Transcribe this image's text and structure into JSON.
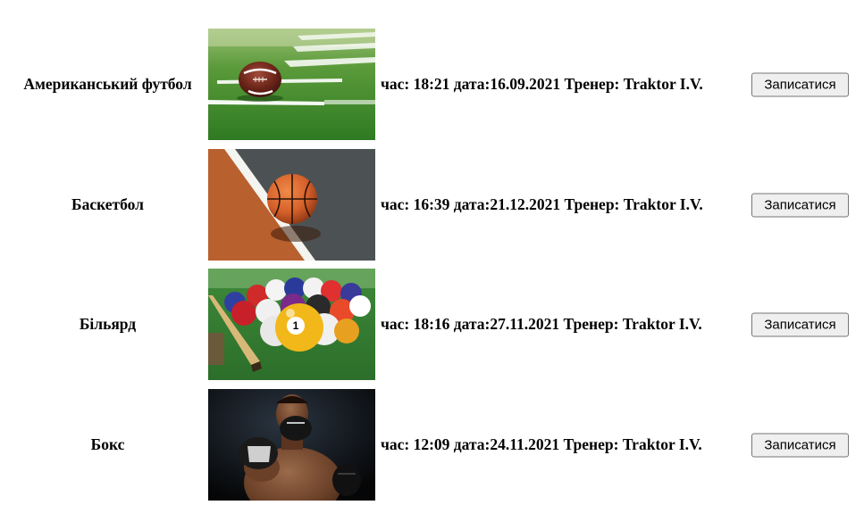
{
  "sections": [
    {
      "name": "Американський футбол",
      "time_label": "час:",
      "time": "18:21",
      "date_label": "дата:",
      "date": "16.09.2021",
      "trainer_label": "Тренер:",
      "trainer": "Traktor I.V.",
      "button_label": "Записатися",
      "image": "american-football-ball-on-field"
    },
    {
      "name": "Баскетбол",
      "time_label": "час:",
      "time": "16:39",
      "date_label": "дата:",
      "date": "21.12.2021",
      "trainer_label": "Тренер:",
      "trainer": "Traktor I.V.",
      "button_label": "Записатися",
      "image": "basketball-on-court"
    },
    {
      "name": "Більярд",
      "time_label": "час:",
      "time": "18:16",
      "date_label": "дата:",
      "date": "27.11.2021",
      "trainer_label": "Тренер:",
      "trainer": "Traktor I.V.",
      "button_label": "Записатися",
      "image": "billiard-balls-and-cue"
    },
    {
      "name": "Бокс",
      "time_label": "час:",
      "time": "12:09",
      "date_label": "дата:",
      "date": "24.11.2021",
      "trainer_label": "Тренер:",
      "trainer": "Traktor I.V.",
      "button_label": "Записатися",
      "image": "boxer-with-gloves"
    }
  ]
}
